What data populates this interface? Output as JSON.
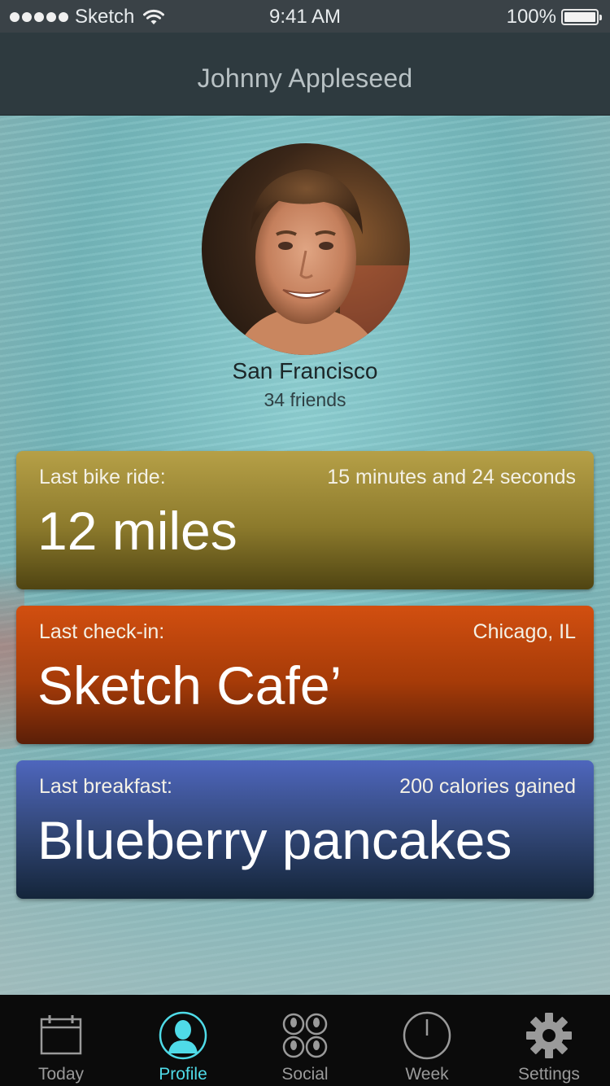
{
  "status_bar": {
    "carrier": "Sketch",
    "time": "9:41 AM",
    "battery_percent": "100%",
    "signal_dots": 5,
    "battery_level": 1.0,
    "icons": [
      "wifi-icon",
      "battery-icon"
    ]
  },
  "nav": {
    "title": "Johnny Appleseed"
  },
  "profile": {
    "location": "San Francisco",
    "friends": "34 friends"
  },
  "cards": {
    "bike": {
      "label": "Last bike ride:",
      "meta": "15 minutes and 24 seconds",
      "value": "12 miles",
      "color": "#8c7a2c"
    },
    "checkin": {
      "label": "Last check-in:",
      "meta": "Chicago, IL",
      "value": "Sketch Cafe’",
      "color": "#a63b08"
    },
    "breakfast": {
      "label": "Last breakfast:",
      "meta": "200 calories gained",
      "value": "Blueberry pancakes",
      "color": "#334879"
    }
  },
  "tabs": {
    "active": "Profile",
    "active_color": "#4fdbe8",
    "items": [
      {
        "label": "Today",
        "icon": "calendar-icon"
      },
      {
        "label": "Profile",
        "icon": "person-icon"
      },
      {
        "label": "Social",
        "icon": "group-icon"
      },
      {
        "label": "Week",
        "icon": "clock-icon"
      },
      {
        "label": "Settings",
        "icon": "gear-icon"
      }
    ]
  }
}
